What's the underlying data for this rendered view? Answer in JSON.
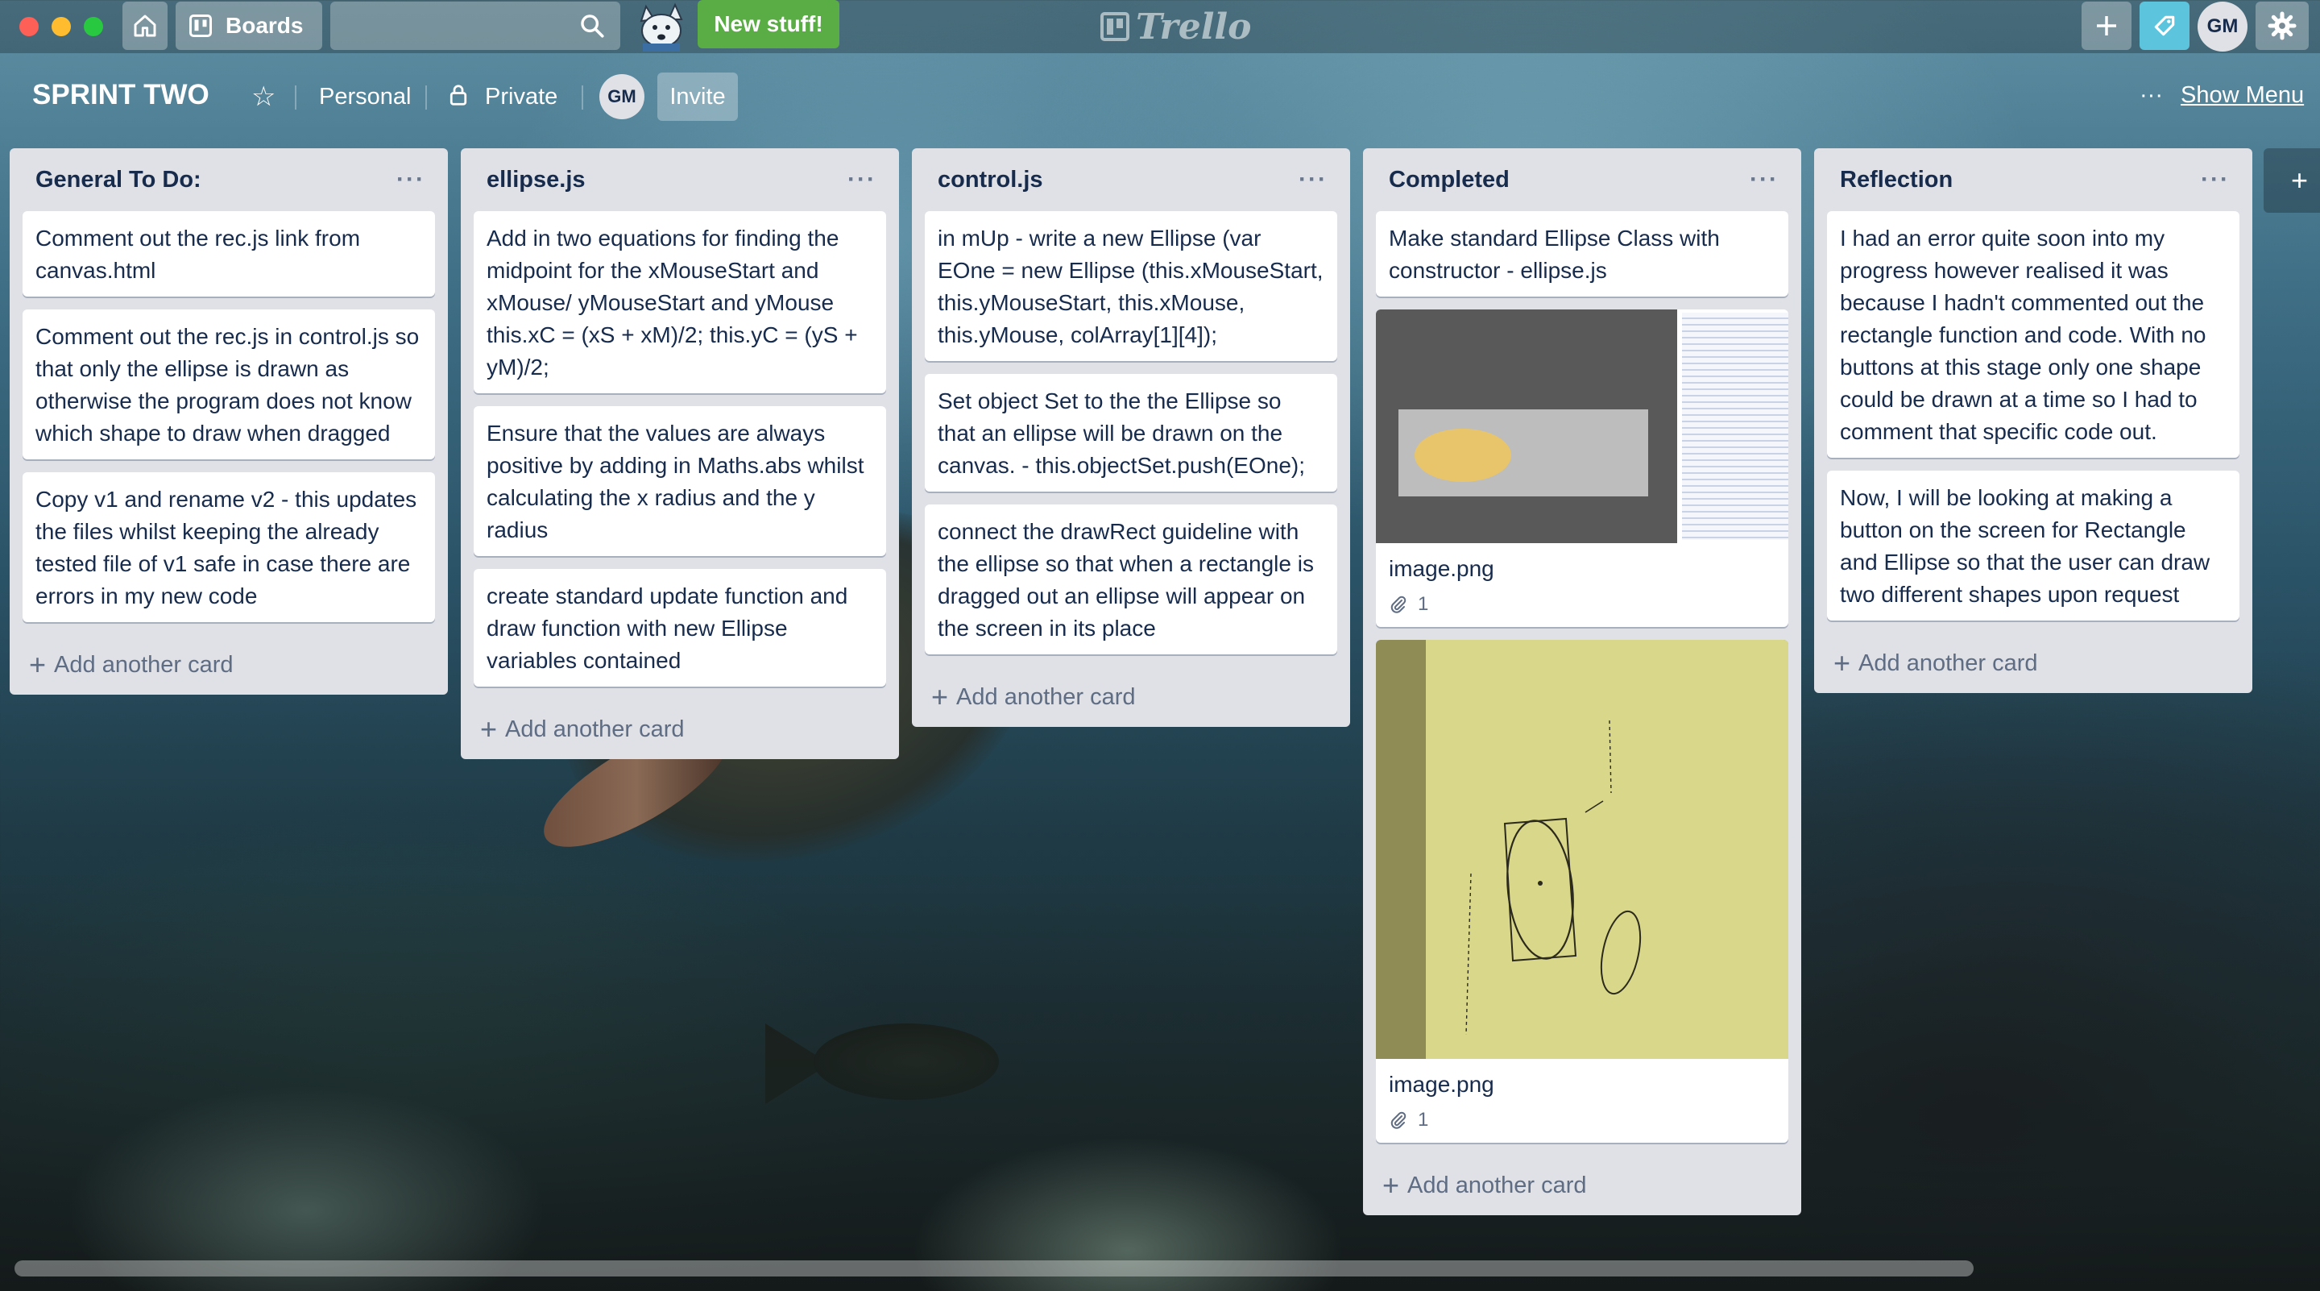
{
  "header": {
    "boards_label": "Boards",
    "new_stuff_label": "New stuff!",
    "logo_text": "Trello",
    "avatar_initials": "GM"
  },
  "board": {
    "title": "SPRINT TWO",
    "team": "Personal",
    "visibility": "Private",
    "member_initials": "GM",
    "invite_label": "Invite",
    "show_menu_label": "Show Menu"
  },
  "add_card_label": "Add another card",
  "lists": [
    {
      "title": "General To Do:",
      "cards": [
        "Comment out the rec.js link from canvas.html",
        "Comment out the rec.js in control.js so that only the ellipse is drawn as otherwise the program does not know which shape to draw when dragged",
        "Copy v1 and rename v2 - this updates the files whilst keeping the already tested file of v1 safe in case there are errors in my new code"
      ]
    },
    {
      "title": "ellipse.js",
      "cards": [
        "Add in two equations for finding the midpoint for the xMouseStart and xMouse/ yMouseStart and yMouse this.xC = (xS + xM)/2; this.yC = (yS + yM)/2;",
        "Ensure that the values are always positive by adding in Maths.abs whilst calculating the x radius and the y radius",
        "create standard update function and draw function with new Ellipse variables contained"
      ]
    },
    {
      "title": "control.js",
      "cards": [
        "in mUp - write a new Ellipse (var EOne = new Ellipse (this.xMouseStart, this.yMouseStart, this.xMouse, this.yMouse, colArray[1][4]);",
        "Set object Set to the the Ellipse so that an ellipse will be drawn on the canvas. - this.objectSet.push(EOne);",
        "connect the drawRect guideline with the ellipse so that when a rectangle is dragged out an ellipse will appear on the screen in its place"
      ]
    },
    {
      "title": "Completed",
      "cards": [
        "Make standard Ellipse Class with constructor - ellipse.js"
      ],
      "image_cards": [
        {
          "name": "image.png",
          "attachments": "1"
        },
        {
          "name": "image.png",
          "attachments": "1"
        }
      ]
    },
    {
      "title": "Reflection",
      "cards": [
        "I had an error quite soon into my progress however realised it was because I hadn't commented out the rectangle function and code. With no buttons at this stage only one shape could be drawn at a time so I had to comment that specific code out.",
        "Now, I will be looking at making a button on the screen for Rectangle and Ellipse so that the user can draw two different shapes upon request"
      ]
    }
  ],
  "colors": {
    "list_bg": "#dfe1e6",
    "card_text": "#172b4d",
    "new_stuff_green": "#5aac44",
    "tip_button": "#5cc4dc"
  }
}
